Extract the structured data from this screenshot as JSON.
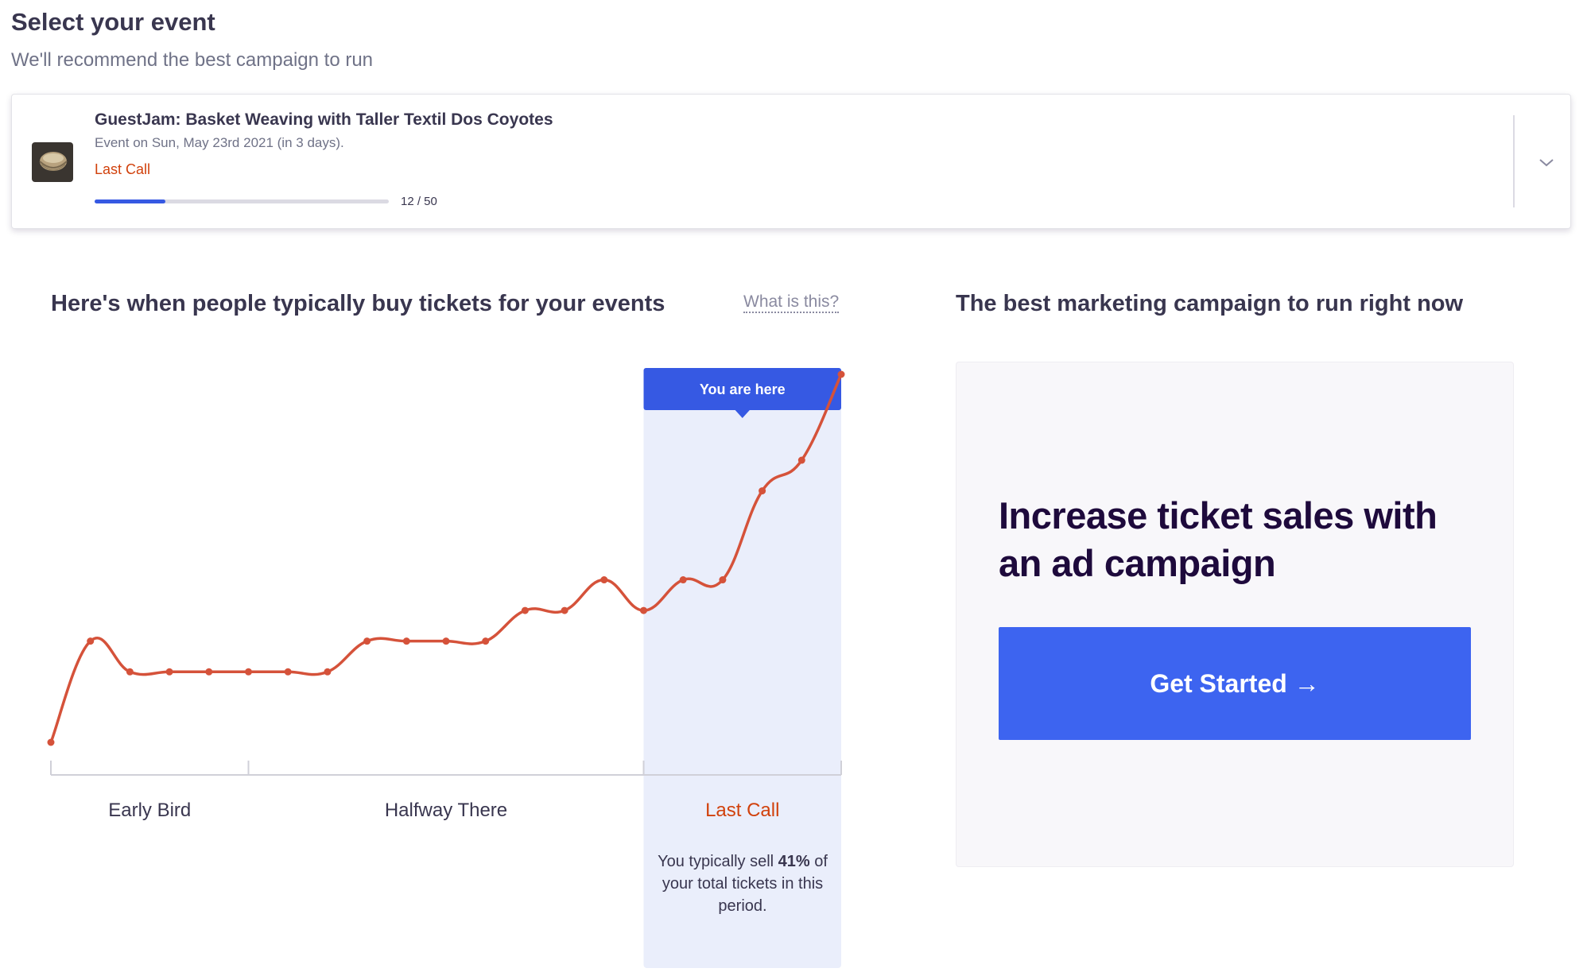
{
  "header": {
    "title": "Select your event",
    "subtitle": "We'll recommend the best campaign to run"
  },
  "event": {
    "name": "GuestJam: Basket Weaving with Taller Textil Dos Coyotes",
    "date": "Event on Sun, May 23rd 2021 (in 3 days).",
    "status": "Last Call",
    "progress_label": "12 / 50",
    "progress_fraction": 0.24
  },
  "chart_section": {
    "heading": "Here's when people typically buy tickets for your events",
    "help_link": "What is this?",
    "marker_label": "You are here",
    "period_note_prefix": "You typically sell ",
    "period_note_percent": "41%",
    "period_note_suffix": " of your total tickets in this period."
  },
  "chart_data": {
    "type": "line",
    "title": "",
    "xlabel": "",
    "ylabel": "",
    "phases": [
      "Early Bird",
      "Halfway There",
      "Last Call"
    ],
    "active_phase": "Last Call",
    "values": [
      0,
      3.3,
      2.3,
      2.3,
      2.3,
      2.3,
      2.3,
      2.3,
      3.3,
      3.3,
      3.3,
      3.3,
      4.3,
      4.3,
      5.3,
      4.3,
      5.3,
      5.3,
      8.2,
      9.2,
      12
    ],
    "ylim": [
      0,
      12
    ],
    "grid": false,
    "line_color": "#d5523a",
    "highlight_color": "#eaeefb",
    "marker_color": "#3659e3"
  },
  "campaign": {
    "heading": "The best marketing campaign to run right now",
    "title": "Increase ticket sales with an ad campaign",
    "button_label": "Get Started →"
  },
  "colors": {
    "accent": "#3d64f0",
    "status_red": "#d1410c",
    "text_dark": "#39364f"
  }
}
